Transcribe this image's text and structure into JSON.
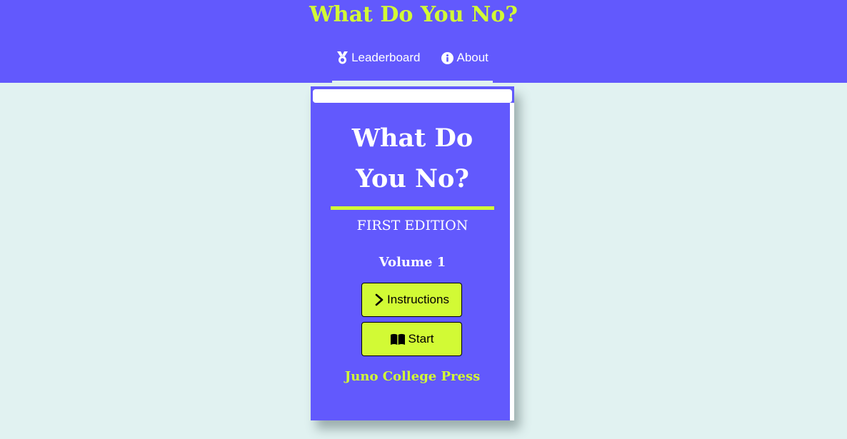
{
  "header": {
    "title": "What Do You No?",
    "nav": [
      {
        "label": "Leaderboard",
        "icon": "medal-icon"
      },
      {
        "label": "About",
        "icon": "info-circle-icon"
      }
    ]
  },
  "book": {
    "title": "What Do You No?",
    "edition": "FIRST EDITION",
    "volume": "Volume 1",
    "buttons": {
      "instructions": {
        "label": "Instructions",
        "icon": "chevron-right-icon"
      },
      "start": {
        "label": "Start",
        "icon": "open-book-icon"
      }
    },
    "publisher": "Juno College Press"
  },
  "colors": {
    "primary": "#6259fd",
    "accent": "#d2fa35",
    "background": "#e1f2f1",
    "text_light": "#ffffff"
  }
}
